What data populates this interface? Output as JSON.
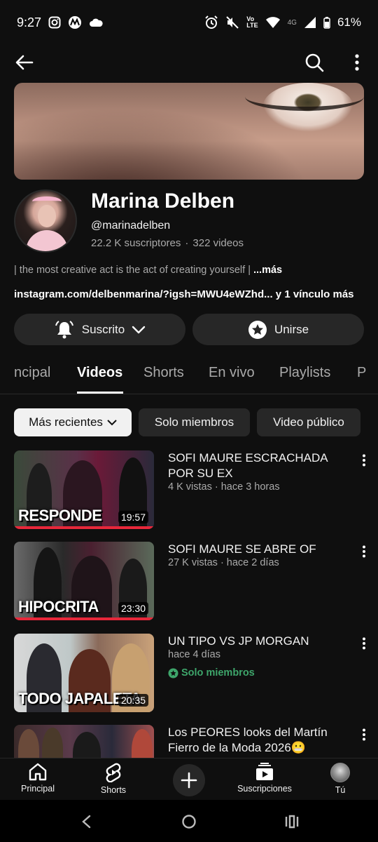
{
  "status_bar": {
    "time": "9:27",
    "battery": "61%",
    "network": "4G"
  },
  "channel": {
    "name": "Marina Delben",
    "handle": "@marinadelben",
    "subscribers": "22.2 K suscriptores",
    "separator": "·",
    "videos_count": "322 videos",
    "description": "| the most creative act is the act of creating yourself | ",
    "description_more": "...más",
    "link": "instagram.com/delbenmarina/?igsh=MWU4eWZhd...",
    "link_extra": " y 1 vínculo más"
  },
  "actions": {
    "subscribed_label": "Suscrito",
    "join_label": "Unirse"
  },
  "tabs": [
    "ncipal",
    "Videos",
    "Shorts",
    "En vivo",
    "Playlists",
    "P"
  ],
  "chips": [
    "Más recientes",
    "Solo miembros",
    "Video público"
  ],
  "videos": [
    {
      "title": "SOFI MAURE ESCRACHADA POR SU EX",
      "meta": "4 K vistas · hace 3 horas",
      "duration": "19:57",
      "overlay": "RESPONDE"
    },
    {
      "title": "SOFI MAURE SE ABRE OF",
      "meta": "27 K vistas · hace 2 días",
      "duration": "23:30",
      "overlay": "HIPOCRITA"
    },
    {
      "title": "UN TIPO VS JP MORGAN",
      "meta": "hace 4 días",
      "badge": "Solo miembros",
      "duration": "20:35",
      "overlay": "TODO JAPALETA"
    },
    {
      "title": "Los PEORES looks del Martín Fierro de la Moda 2026😬"
    }
  ],
  "bottom_nav": {
    "home": "Principal",
    "shorts": "Shorts",
    "subscriptions": "Suscripciones",
    "you": "Tú"
  },
  "colors": {
    "background": "#0f0f0f",
    "chip": "#272727",
    "members_green": "#3ea66b",
    "progress_red": "#e8273a"
  }
}
